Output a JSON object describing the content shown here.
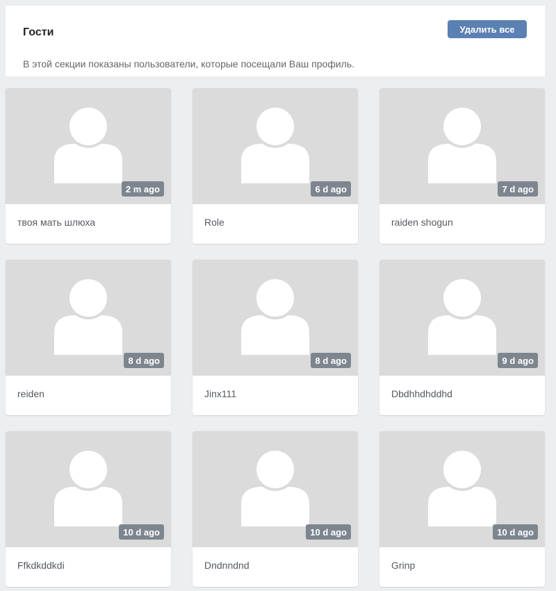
{
  "header": {
    "title": "Гости",
    "description": "В этой секции показаны пользователи, которые посещали Ваш профиль.",
    "delete_all_label": "Удалить все"
  },
  "guests": [
    {
      "name": "твоя мать шлюха",
      "time": "2 m ago"
    },
    {
      "name": "Role",
      "time": "6 d ago"
    },
    {
      "name": "raiden shogun",
      "time": "7 d ago"
    },
    {
      "name": "reiden",
      "time": "8 d ago"
    },
    {
      "name": "Jinx111",
      "time": "8 d ago"
    },
    {
      "name": "Dbdhhdhddhd",
      "time": "9 d ago"
    },
    {
      "name": "Ffkdkddkdi",
      "time": "10 d ago"
    },
    {
      "name": "Dndnndnd",
      "time": "10 d ago"
    },
    {
      "name": "Grinp",
      "time": "10 d ago"
    }
  ],
  "colors": {
    "page_background": "#edeef0",
    "card_photo": "#dbdbdb",
    "button": "#5b80b3",
    "time_badge": "#7d868f"
  },
  "icons": {
    "avatar": "user-placeholder-icon"
  }
}
